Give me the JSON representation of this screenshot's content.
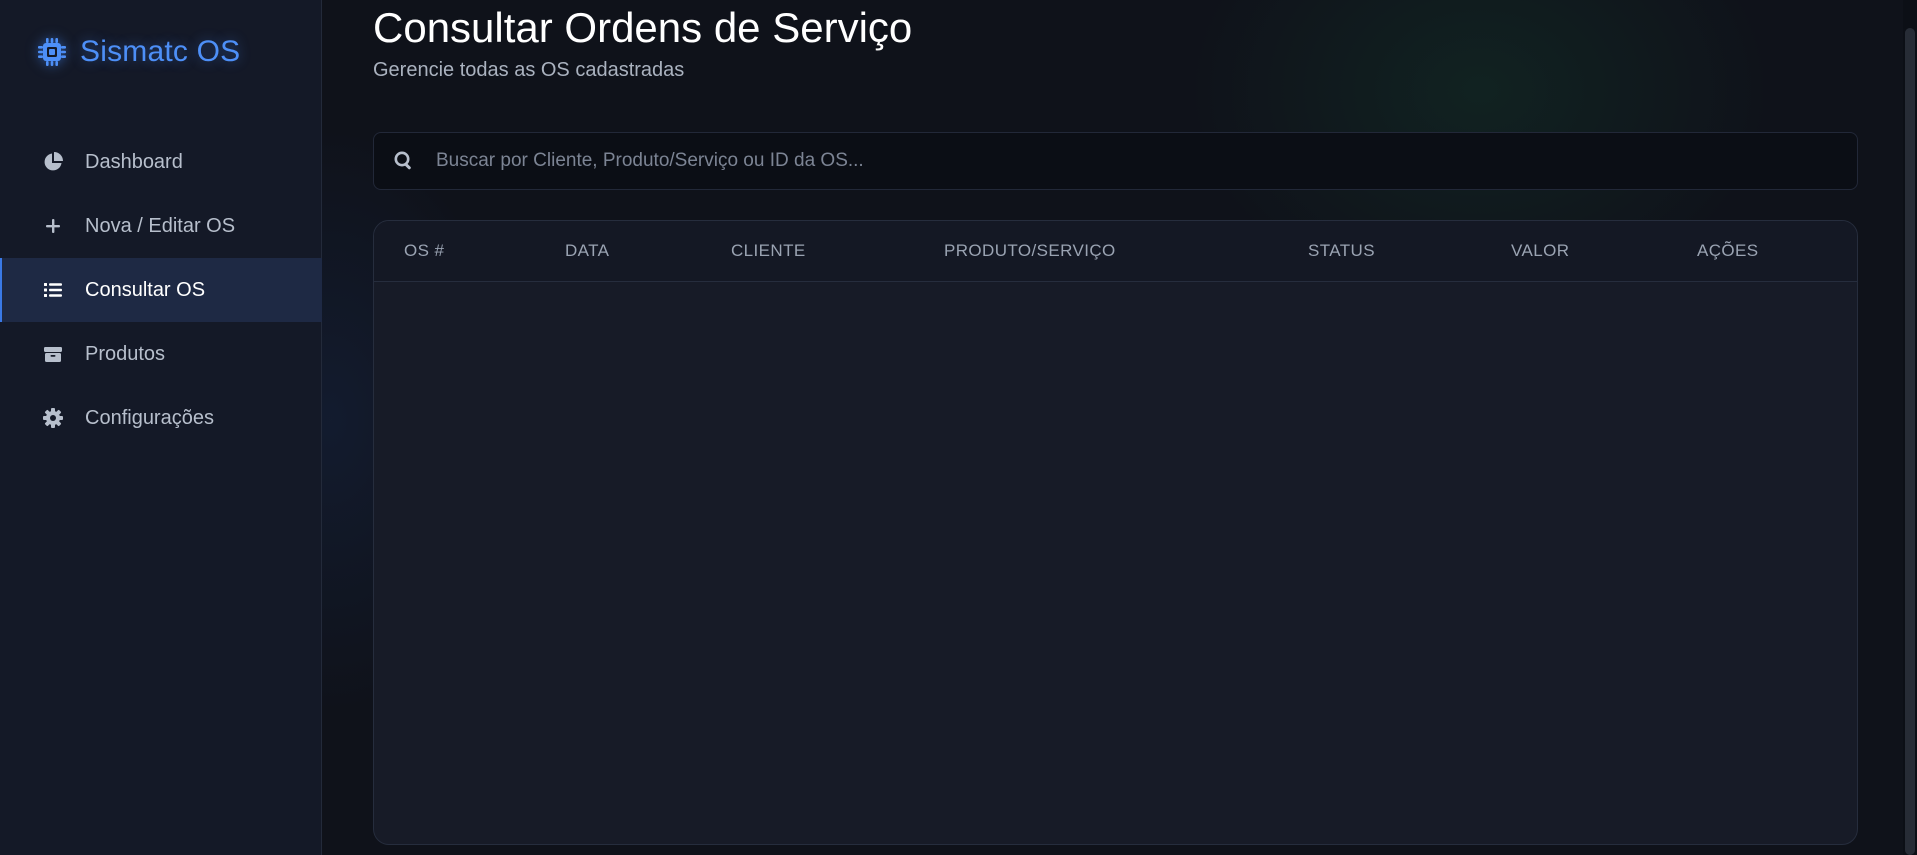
{
  "brand": {
    "title": "Sismatc OS",
    "icon": "cpu-chip-icon",
    "color": "#4d8ff7"
  },
  "sidebar": {
    "items": [
      {
        "label": "Dashboard",
        "icon": "pie-chart-icon",
        "active": false
      },
      {
        "label": "Nova / Editar OS",
        "icon": "plus-icon",
        "active": false
      },
      {
        "label": "Consultar OS",
        "icon": "list-icon",
        "active": true
      },
      {
        "label": "Produtos",
        "icon": "box-icon",
        "active": false
      },
      {
        "label": "Configurações",
        "icon": "gear-icon",
        "active": false
      }
    ]
  },
  "page": {
    "title": "Consultar Ordens de Serviço",
    "subtitle": "Gerencie todas as OS cadastradas"
  },
  "search": {
    "placeholder": "Buscar por Cliente, Produto/Serviço ou ID da OS...",
    "value": "",
    "icon": "search-icon"
  },
  "table": {
    "columns": [
      "OS #",
      "DATA",
      "CLIENTE",
      "PRODUTO/SERVIÇO",
      "STATUS",
      "VALOR",
      "AÇÕES"
    ],
    "rows": []
  },
  "colors": {
    "accent": "#3a79e6",
    "active_bg": "#1e2944",
    "sidebar_bg": "#141927",
    "page_bg": "#0f121a"
  }
}
